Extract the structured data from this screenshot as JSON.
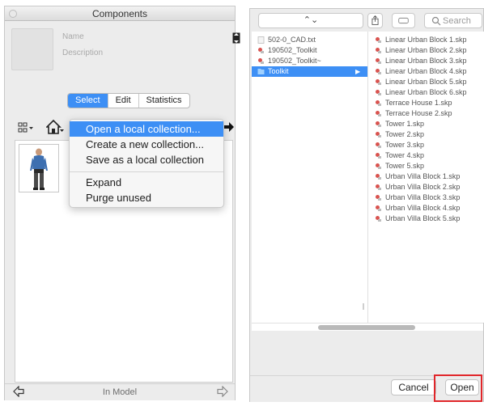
{
  "components_panel": {
    "title": "Components",
    "name_label": "Name",
    "description_label": "Description",
    "tabs": [
      {
        "label": "Select",
        "active": true
      },
      {
        "label": "Edit",
        "active": false
      },
      {
        "label": "Statistics",
        "active": false
      }
    ],
    "status": "In Model",
    "menu": {
      "items": [
        {
          "label": "Open a local collection...",
          "highlighted": true
        },
        {
          "label": "Create a new collection...",
          "highlighted": false
        },
        {
          "label": "Save as a local collection",
          "highlighted": false
        },
        {
          "label": "Expand",
          "highlighted": false
        },
        {
          "label": "Purge unused",
          "highlighted": false
        }
      ]
    },
    "colors": {
      "accent": "#3d8ff5"
    }
  },
  "file_browser": {
    "path_symbol": "⌃⌄",
    "search_placeholder": "Search",
    "column1": [
      {
        "name": "502-0_CAD.txt",
        "type": "text"
      },
      {
        "name": "190502_Toolkit",
        "type": "skp"
      },
      {
        "name": "190502_Toolkit~",
        "type": "skp"
      },
      {
        "name": "Toolkit",
        "type": "folder",
        "selected": true
      }
    ],
    "column2": [
      "Linear Urban Block 1.skp",
      "Linear Urban Block 2.skp",
      "Linear Urban Block 3.skp",
      "Linear Urban Block 4.skp",
      "Linear Urban Block 5.skp",
      "Linear Urban Block 6.skp",
      "Terrace House 1.skp",
      "Terrace House 2.skp",
      "Tower 1.skp",
      "Tower 2.skp",
      "Tower 3.skp",
      "Tower 4.skp",
      "Tower 5.skp",
      "Urban Villa Block 1.skp",
      "Urban Villa Block 2.skp",
      "Urban Villa Block 3.skp",
      "Urban Villa Block 4.skp",
      "Urban Villa Block 5.skp"
    ],
    "cancel_label": "Cancel",
    "open_label": "Open",
    "colors": {
      "highlight_box": "#e1262a",
      "selection": "#3d8ff5"
    }
  }
}
